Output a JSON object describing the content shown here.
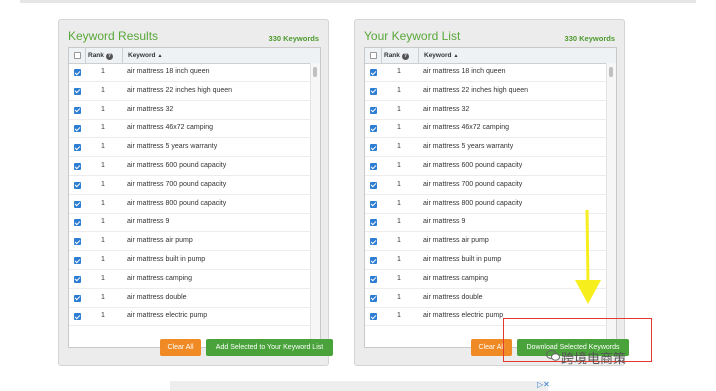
{
  "rank_header": "Rank",
  "keyword_header": "Keyword",
  "left_panel": {
    "title": "Keyword Results",
    "count": "330 Keywords",
    "clear_label": "Clear All",
    "add_label": "Add Selected to Your Keyword List"
  },
  "right_panel": {
    "title": "Your Keyword List",
    "count": "330 Keywords",
    "clear_label": "Clear All",
    "download_label": "Download Selected Keywords"
  },
  "rows": [
    {
      "rank": "1",
      "keyword": "air mattress 18 inch queen"
    },
    {
      "rank": "1",
      "keyword": "air mattress 22 inches high queen"
    },
    {
      "rank": "1",
      "keyword": "air mattress 32"
    },
    {
      "rank": "1",
      "keyword": "air mattress 46x72 camping"
    },
    {
      "rank": "1",
      "keyword": "air mattress 5 years warranty"
    },
    {
      "rank": "1",
      "keyword": "air mattress 600 pound capacity"
    },
    {
      "rank": "1",
      "keyword": "air mattress 700 pound capacity"
    },
    {
      "rank": "1",
      "keyword": "air mattress 800 pound capacity"
    },
    {
      "rank": "1",
      "keyword": "air mattress 9"
    },
    {
      "rank": "1",
      "keyword": "air mattress air pump"
    },
    {
      "rank": "1",
      "keyword": "air mattress built in pump"
    },
    {
      "rank": "1",
      "keyword": "air mattress camping"
    },
    {
      "rank": "1",
      "keyword": "air mattress double"
    },
    {
      "rank": "1",
      "keyword": "air mattress electric pump"
    }
  ],
  "watermark": "跨境电商策",
  "colors": {
    "accent_green": "#49a33a",
    "orange": "#ef8a24",
    "checkbox_blue": "#2d7dd2",
    "annotation_red": "#e23b2e",
    "arrow_yellow": "#f7ee1e"
  }
}
